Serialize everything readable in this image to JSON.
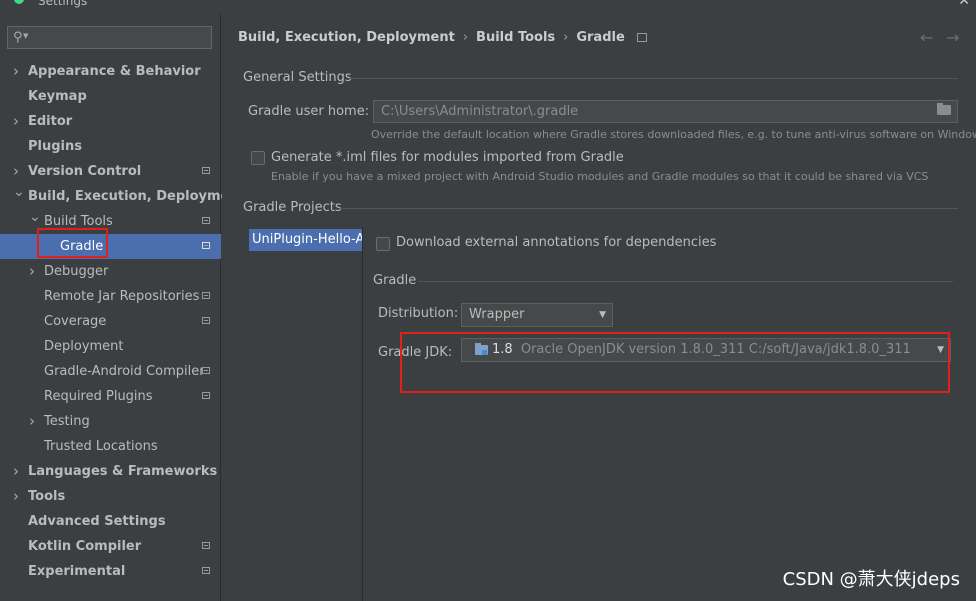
{
  "window": {
    "title": "Settings",
    "accent_color": "#4b6eaf",
    "highlight_color": "#e0211a"
  },
  "search": {
    "placeholder": ""
  },
  "sidebar": {
    "items": [
      {
        "label": "Appearance & Behavior",
        "indent": 0,
        "arrow": "right",
        "bold": true,
        "project": false,
        "selected": false
      },
      {
        "label": "Keymap",
        "indent": 0,
        "arrow": "none",
        "bold": true,
        "project": false,
        "selected": false
      },
      {
        "label": "Editor",
        "indent": 0,
        "arrow": "right",
        "bold": true,
        "project": false,
        "selected": false
      },
      {
        "label": "Plugins",
        "indent": 0,
        "arrow": "none",
        "bold": true,
        "project": false,
        "selected": false
      },
      {
        "label": "Version Control",
        "indent": 0,
        "arrow": "right",
        "bold": true,
        "project": true,
        "selected": false
      },
      {
        "label": "Build, Execution, Deployment",
        "indent": 0,
        "arrow": "down",
        "bold": true,
        "project": false,
        "selected": false
      },
      {
        "label": "Build Tools",
        "indent": 1,
        "arrow": "down",
        "bold": false,
        "project": true,
        "selected": false
      },
      {
        "label": "Gradle",
        "indent": 2,
        "arrow": "none",
        "bold": false,
        "project": true,
        "selected": true
      },
      {
        "label": "Debugger",
        "indent": 1,
        "arrow": "right",
        "bold": false,
        "project": false,
        "selected": false
      },
      {
        "label": "Remote Jar Repositories",
        "indent": 1,
        "arrow": "none",
        "bold": false,
        "project": true,
        "selected": false
      },
      {
        "label": "Coverage",
        "indent": 1,
        "arrow": "none",
        "bold": false,
        "project": true,
        "selected": false
      },
      {
        "label": "Deployment",
        "indent": 1,
        "arrow": "none",
        "bold": false,
        "project": false,
        "selected": false
      },
      {
        "label": "Gradle-Android Compiler",
        "indent": 1,
        "arrow": "none",
        "bold": false,
        "project": true,
        "selected": false
      },
      {
        "label": "Required Plugins",
        "indent": 1,
        "arrow": "none",
        "bold": false,
        "project": true,
        "selected": false
      },
      {
        "label": "Testing",
        "indent": 1,
        "arrow": "right",
        "bold": false,
        "project": false,
        "selected": false
      },
      {
        "label": "Trusted Locations",
        "indent": 1,
        "arrow": "none",
        "bold": false,
        "project": false,
        "selected": false
      },
      {
        "label": "Languages & Frameworks",
        "indent": 0,
        "arrow": "right",
        "bold": true,
        "project": false,
        "selected": false
      },
      {
        "label": "Tools",
        "indent": 0,
        "arrow": "right",
        "bold": true,
        "project": false,
        "selected": false
      },
      {
        "label": "Advanced Settings",
        "indent": 0,
        "arrow": "none",
        "bold": true,
        "project": false,
        "selected": false
      },
      {
        "label": "Kotlin Compiler",
        "indent": 0,
        "arrow": "none",
        "bold": true,
        "project": true,
        "selected": false
      },
      {
        "label": "Experimental",
        "indent": 0,
        "arrow": "none",
        "bold": true,
        "project": true,
        "selected": false
      }
    ]
  },
  "breadcrumb": {
    "items": [
      "Build, Execution, Deployment",
      "Build Tools",
      "Gradle"
    ],
    "separator": "›"
  },
  "nav": {
    "back": "←",
    "forward": "→"
  },
  "general": {
    "title": "General Settings",
    "user_home_label": "Gradle user home:",
    "user_home_value": "C:\\Users\\Administrator\\.gradle",
    "user_home_hint": "Override the default location where Gradle stores downloaded files, e.g. to tune anti-virus software on Windows",
    "iml_label": "Generate *.iml files for modules imported from Gradle",
    "iml_hint": "Enable if you have a mixed project with Android Studio modules and Gradle modules so that it could be shared via VCS"
  },
  "projects": {
    "title": "Gradle Projects",
    "list": [
      "UniPlugin-Hello-AS"
    ],
    "download_annotations_label": "Download external annotations for dependencies",
    "gradle_section": "Gradle",
    "distribution_label": "Distribution:",
    "distribution_value": "Wrapper",
    "jdk_label": "Gradle JDK:",
    "jdk_version": "1.8",
    "jdk_detail": "Oracle OpenJDK version 1.8.0_311 C:/soft/Java/jdk1.8.0_311"
  },
  "watermark": "CSDN @萧大侠jdeps"
}
